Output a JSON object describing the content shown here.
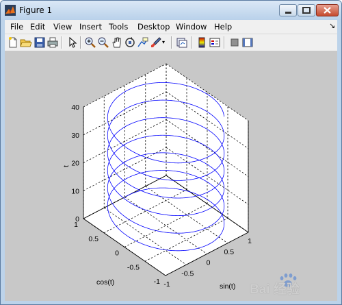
{
  "window": {
    "title": "Figure 1"
  },
  "menu": {
    "items": [
      "File",
      "Edit",
      "View",
      "Insert",
      "Tools",
      "Desktop",
      "Window",
      "Help"
    ],
    "overflow_arrow": "↘"
  },
  "toolbar": {
    "icons": [
      "new-figure-icon",
      "open-file-icon",
      "save-icon",
      "print-icon",
      "edit-plot-arrow-icon",
      "zoom-in-icon",
      "zoom-out-icon",
      "pan-hand-icon",
      "rotate-3d-icon",
      "data-cursor-icon",
      "brush-icon",
      "link-plot-icon",
      "colorbar-icon",
      "legend-icon",
      "hide-plot-tools-icon",
      "show-plot-tools-icon"
    ]
  },
  "chart_data": {
    "type": "line3d",
    "function": "x = sin(t), y = cos(t), z = t",
    "t_range": [
      0,
      40
    ],
    "xlabel": "sin(t)",
    "ylabel": "cos(t)",
    "zlabel": "t",
    "xlim": [
      -1,
      1
    ],
    "ylim": [
      -1,
      1
    ],
    "zlim": [
      0,
      40
    ],
    "x_ticks": [
      "-1",
      "-0.5",
      "0",
      "0.5",
      "1"
    ],
    "y_ticks": [
      "-1",
      "-0.5",
      "0",
      "0.5",
      "1"
    ],
    "z_ticks": [
      "0",
      "10",
      "20",
      "30",
      "40"
    ],
    "grid": true,
    "line_color": "#0000ff"
  },
  "watermark": {
    "text": "Bai 经验"
  },
  "colors": {
    "figure_bg": "#c8c8c8",
    "axes_bg": "#ffffff",
    "line": "#0000ff"
  }
}
